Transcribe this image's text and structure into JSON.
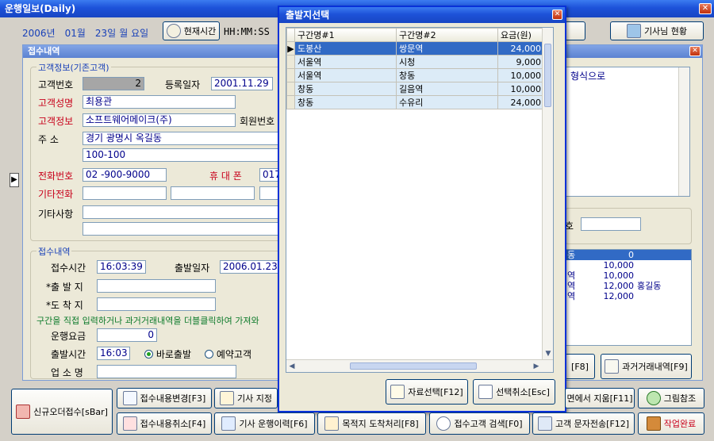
{
  "window": {
    "title": "운행일보(Daily)",
    "close": "✕"
  },
  "datebar": {
    "year": "2006년",
    "month": "01월",
    "day": "23일",
    "weekday": "월 요일",
    "time_btn": "현재시간",
    "time_format": "HH:MM:SS"
  },
  "topright": {
    "driver_status": "기사님 현황"
  },
  "reception": {
    "title": "접수내역",
    "close": "✕"
  },
  "customer": {
    "group_label": "고객정보(기존고객)",
    "number_label": "고객번호",
    "number": "2",
    "regdate_label": "등록일자",
    "regdate": "2001.11.29",
    "name_label": "고객성명",
    "name": "최용관",
    "info_label": "고객정보",
    "info": "소프트웨어메이크(주)",
    "member_label": "회원번호",
    "addr_label": "주    소",
    "addr1": "경기 광명시 옥길동",
    "addr2": "100-100",
    "phone_label": "전화번호",
    "phone": "02  -900-9000",
    "mobile_label": "휴 대 폰",
    "mobile": "017",
    "other_phone_label": "기타전화",
    "other_label": "기타사항"
  },
  "receipt": {
    "group_label": "접수내역",
    "time_label": "접수시간",
    "time": "16:03:39",
    "depdate_label": "출발일자",
    "depdate": "2006.01.23",
    "origin_label": "*출 발 지",
    "dest_label": "*도 착 지",
    "hint": "구간을 직접 입력하거나 과거거래내역을 더블클릭하여 가져와",
    "fare_label": "운행요금",
    "fare": "0",
    "deptime_label": "출발시간",
    "deptime": "16:03",
    "radio_now": "바로출발",
    "radio_reserve": "예약고객",
    "company_label": "업 소 명"
  },
  "right_panel": {
    "memo_text": "형식으로",
    "number_label": "호",
    "history": [
      {
        "col1": "동",
        "col2": "0",
        "col3": ""
      },
      {
        "col1": "",
        "col2": "10,000",
        "col3": ""
      },
      {
        "col1": "역",
        "col2": "10,000",
        "col3": ""
      },
      {
        "col1": "역",
        "col2": "12,000",
        "col3": "홍길동"
      },
      {
        "col1": "역",
        "col2": "12,000",
        "col3": ""
      }
    ],
    "f8_btn": "[F8]",
    "history_btn": "과거거래내역[F9]"
  },
  "popup": {
    "title": "출발지선택",
    "close": "✕",
    "columns": [
      "구간명#1",
      "구간명#2",
      "요금(원)"
    ],
    "rows": [
      {
        "a": "도봉산",
        "b": "쌍문역",
        "c": "24,000"
      },
      {
        "a": "서울역",
        "b": "시청",
        "c": "9,000"
      },
      {
        "a": "서울역",
        "b": "창동",
        "c": "10,000"
      },
      {
        "a": "창동",
        "b": "길음역",
        "c": "10,000"
      },
      {
        "a": "창동",
        "b": "수유리",
        "c": "24,000"
      }
    ],
    "select_btn": "자료선택[F12]",
    "cancel_btn": "선택취소[Esc]"
  },
  "bottom": {
    "new_order": "신규오더접수[sBar]",
    "change": "접수내용변경[F3]",
    "driver_assign": "기사 지정",
    "remove_list": "면에서 지움[F11]",
    "picture": "그림참조",
    "cancel": "접수내용취소[F4]",
    "driver_log": "기사 운행이력[F6]",
    "arrival": "목적지 도착처리[F8]",
    "search": "접수고객 검색[F0]",
    "sms": "고객 문자전송[F12]",
    "done": "작업완료"
  }
}
